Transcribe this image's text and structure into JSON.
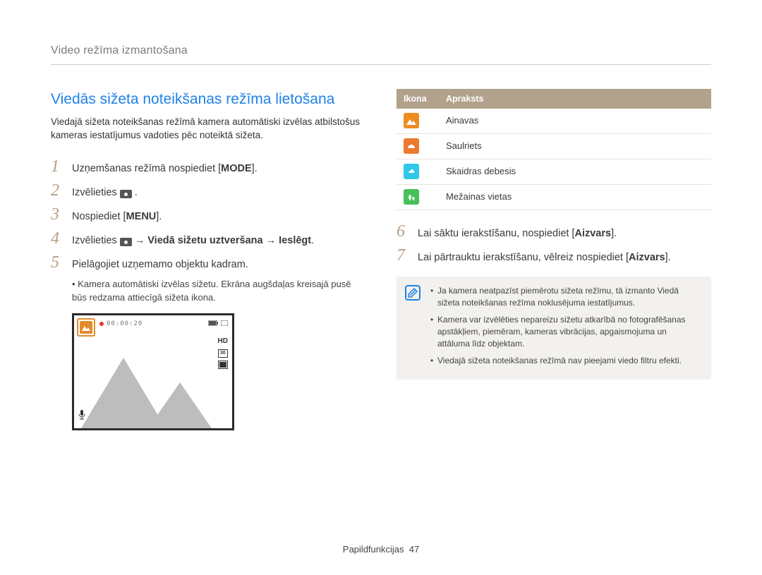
{
  "breadcrumb": "Video režīma izmantošana",
  "section_title": "Viedās sižeta noteikšanas režīma lietošana",
  "intro": "Viedajā sižeta noteikšanas režīmā kamera automātiski izvēlas atbilstošus kameras iestatījumus vadoties pēc noteiktā sižeta.",
  "steps_left": [
    {
      "num": "1",
      "text_pre": "Uzņemšanas režīmā nospiediet [",
      "key": "MODE",
      "text_post": "]."
    },
    {
      "num": "2",
      "text_pre": "Izvēlieties ",
      "icon": "video",
      "text_post": " ."
    },
    {
      "num": "3",
      "text_pre": "Nospiediet [",
      "key": "MENU",
      "text_post": "]."
    },
    {
      "num": "4",
      "text_pre": "Izvēlieties ",
      "icon": "video",
      "arrow1": " → ",
      "key2": "Viedā sižetu uztveršana",
      "arrow2": " → ",
      "key3": "Ieslēgt",
      "text_post": "."
    },
    {
      "num": "5",
      "text_pre": "Pielāgojiet uzņemamo objektu kadram."
    }
  ],
  "step5_sub": "Kamera automātiski izvēlas sižetu. Ekrāna augšdaļas kreisajā pusē būs redzama attiecīgā sižeta ikona.",
  "preview": {
    "time": "00:00:20",
    "hd": "HD",
    "mode30": "30"
  },
  "table": {
    "head_icon": "Ikona",
    "head_desc": "Apraksts",
    "rows": [
      {
        "color": "orange",
        "label": "Ainavas"
      },
      {
        "color": "orange2",
        "label": "Saulriets"
      },
      {
        "color": "cyan",
        "label": "Skaidras debesis"
      },
      {
        "color": "green",
        "label": "Mežainas vietas"
      }
    ]
  },
  "steps_right": [
    {
      "num": "6",
      "text_pre": "Lai sāktu ierakstīšanu, nospiediet [",
      "key": "Aizvars",
      "text_post": "]."
    },
    {
      "num": "7",
      "text_pre": "Lai pārtrauktu ierakstīšanu, vēlreiz nospiediet [",
      "key": "Aizvars",
      "text_post": "]."
    }
  ],
  "notes": [
    "Ja kamera neatpazīst piemērotu sižeta režīmu, tā izmanto Viedā sižeta noteikšanas režīma noklusējuma iestatījumus.",
    "Kamera var izvēlēties nepareizu sižetu atkarībā no fotografēšanas apstākļiem, piemēram, kameras vibrācijas, apgaismojuma un attāluma līdz objektam.",
    "Viedajā sižeta noteikšanas režīmā nav pieejami viedo filtru efekti."
  ],
  "footer": {
    "section": "Papildfunkcijas",
    "page": "47"
  }
}
